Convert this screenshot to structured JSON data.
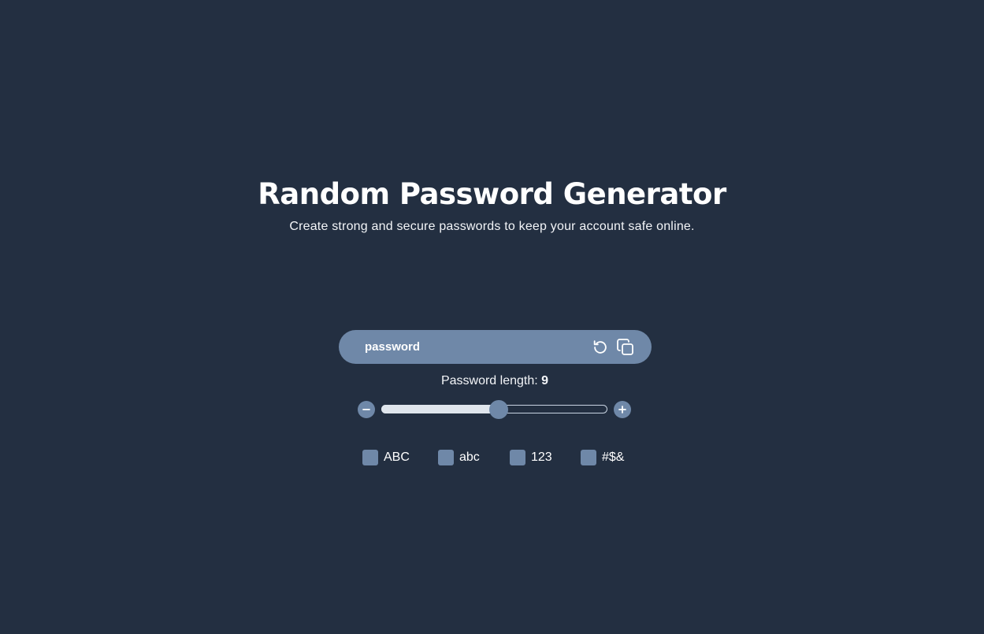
{
  "header": {
    "title": "Random Password Generator",
    "subtitle": "Create strong and secure passwords to keep your account safe online."
  },
  "password": {
    "value": "password",
    "refresh_icon": "refresh-icon",
    "copy_icon": "copy-icon"
  },
  "length": {
    "label": "Password length: ",
    "value": "9",
    "slider_fraction": 0.52,
    "decrement_icon": "minus-icon",
    "increment_icon": "plus-icon"
  },
  "options": [
    {
      "label": "ABC",
      "checked": false
    },
    {
      "label": "abc",
      "checked": false
    },
    {
      "label": "123",
      "checked": false
    },
    {
      "label": "#$&",
      "checked": false
    }
  ],
  "colors": {
    "background": "#232f41",
    "accent": "#6f88a8",
    "slider_fill": "#dfe5ec",
    "text": "#ffffff"
  }
}
